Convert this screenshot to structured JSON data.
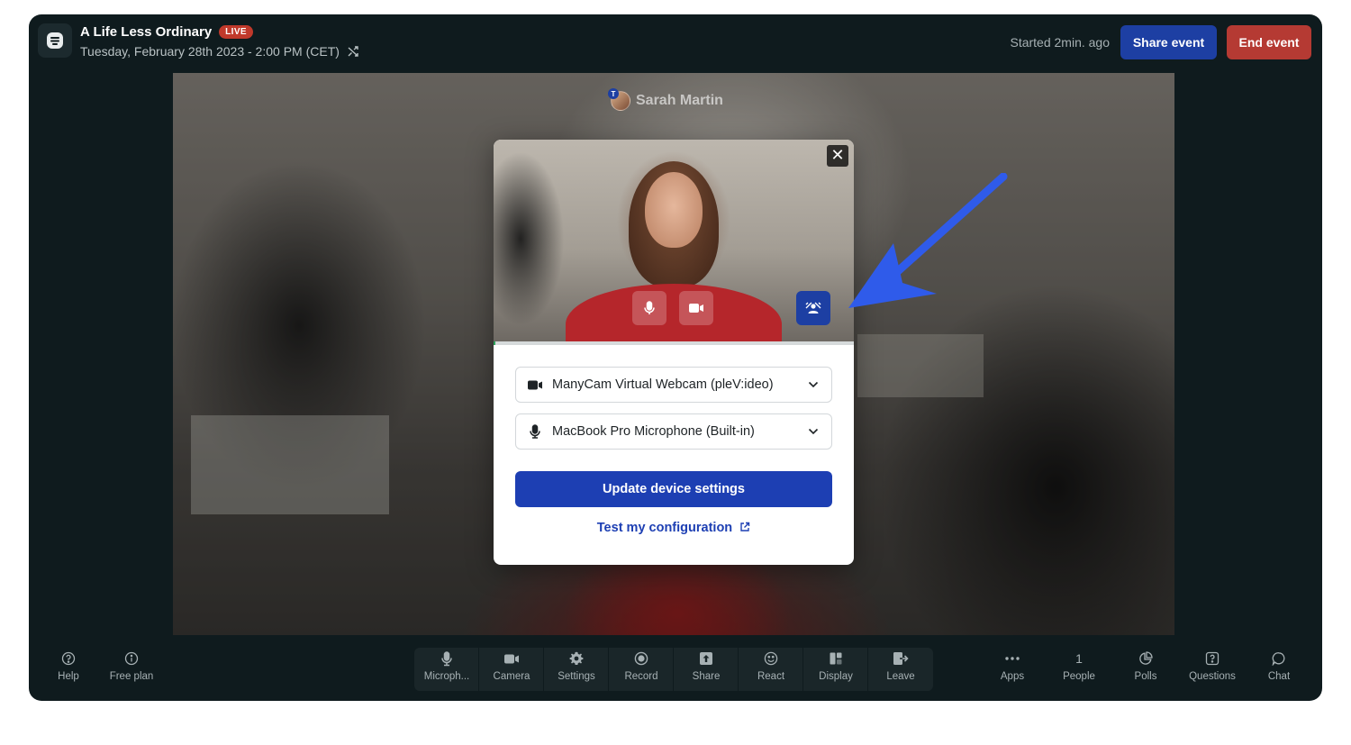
{
  "header": {
    "title": "A Life Less Ordinary",
    "live_badge": "LIVE",
    "date": "Tuesday, February 28th 2023 - 2:00 PM (CET)",
    "started": "Started 2min. ago",
    "share_label": "Share event",
    "end_label": "End event"
  },
  "stage": {
    "speaker_initial": "T",
    "speaker_name": "Sarah Martin"
  },
  "modal": {
    "close": "✕",
    "camera_select": "ManyCam Virtual Webcam (pleV:ideo)",
    "mic_select": "MacBook Pro Microphone (Built-in)",
    "update_label": "Update device settings",
    "test_label": "Test my configuration",
    "test_icon": "external-link-icon",
    "mic_level": 0.005
  },
  "toolbar": {
    "left": [
      {
        "label": "Help",
        "icon": "help-circle-icon"
      },
      {
        "label": "Free plan",
        "icon": "info-circle-icon"
      }
    ],
    "center": [
      {
        "label": "Microph...",
        "icon": "microphone-icon"
      },
      {
        "label": "Camera",
        "icon": "camera-icon"
      },
      {
        "label": "Settings",
        "icon": "gear-icon"
      },
      {
        "label": "Record",
        "icon": "record-icon"
      },
      {
        "label": "Share",
        "icon": "share-screen-icon"
      },
      {
        "label": "React",
        "icon": "smile-icon"
      },
      {
        "label": "Display",
        "icon": "layout-icon"
      },
      {
        "label": "Leave",
        "icon": "leave-icon"
      }
    ],
    "right": [
      {
        "label": "Apps",
        "icon": "dots-icon"
      },
      {
        "label": "People",
        "count": "1"
      },
      {
        "label": "Polls",
        "icon": "pie-chart-icon"
      },
      {
        "label": "Questions",
        "icon": "question-square-icon"
      },
      {
        "label": "Chat",
        "icon": "chat-bubble-icon"
      }
    ]
  },
  "colors": {
    "background": "#0f1b1e",
    "primary": "#1d3fa3",
    "danger": "#b53a33",
    "annotation_arrow": "#2f5bea"
  }
}
